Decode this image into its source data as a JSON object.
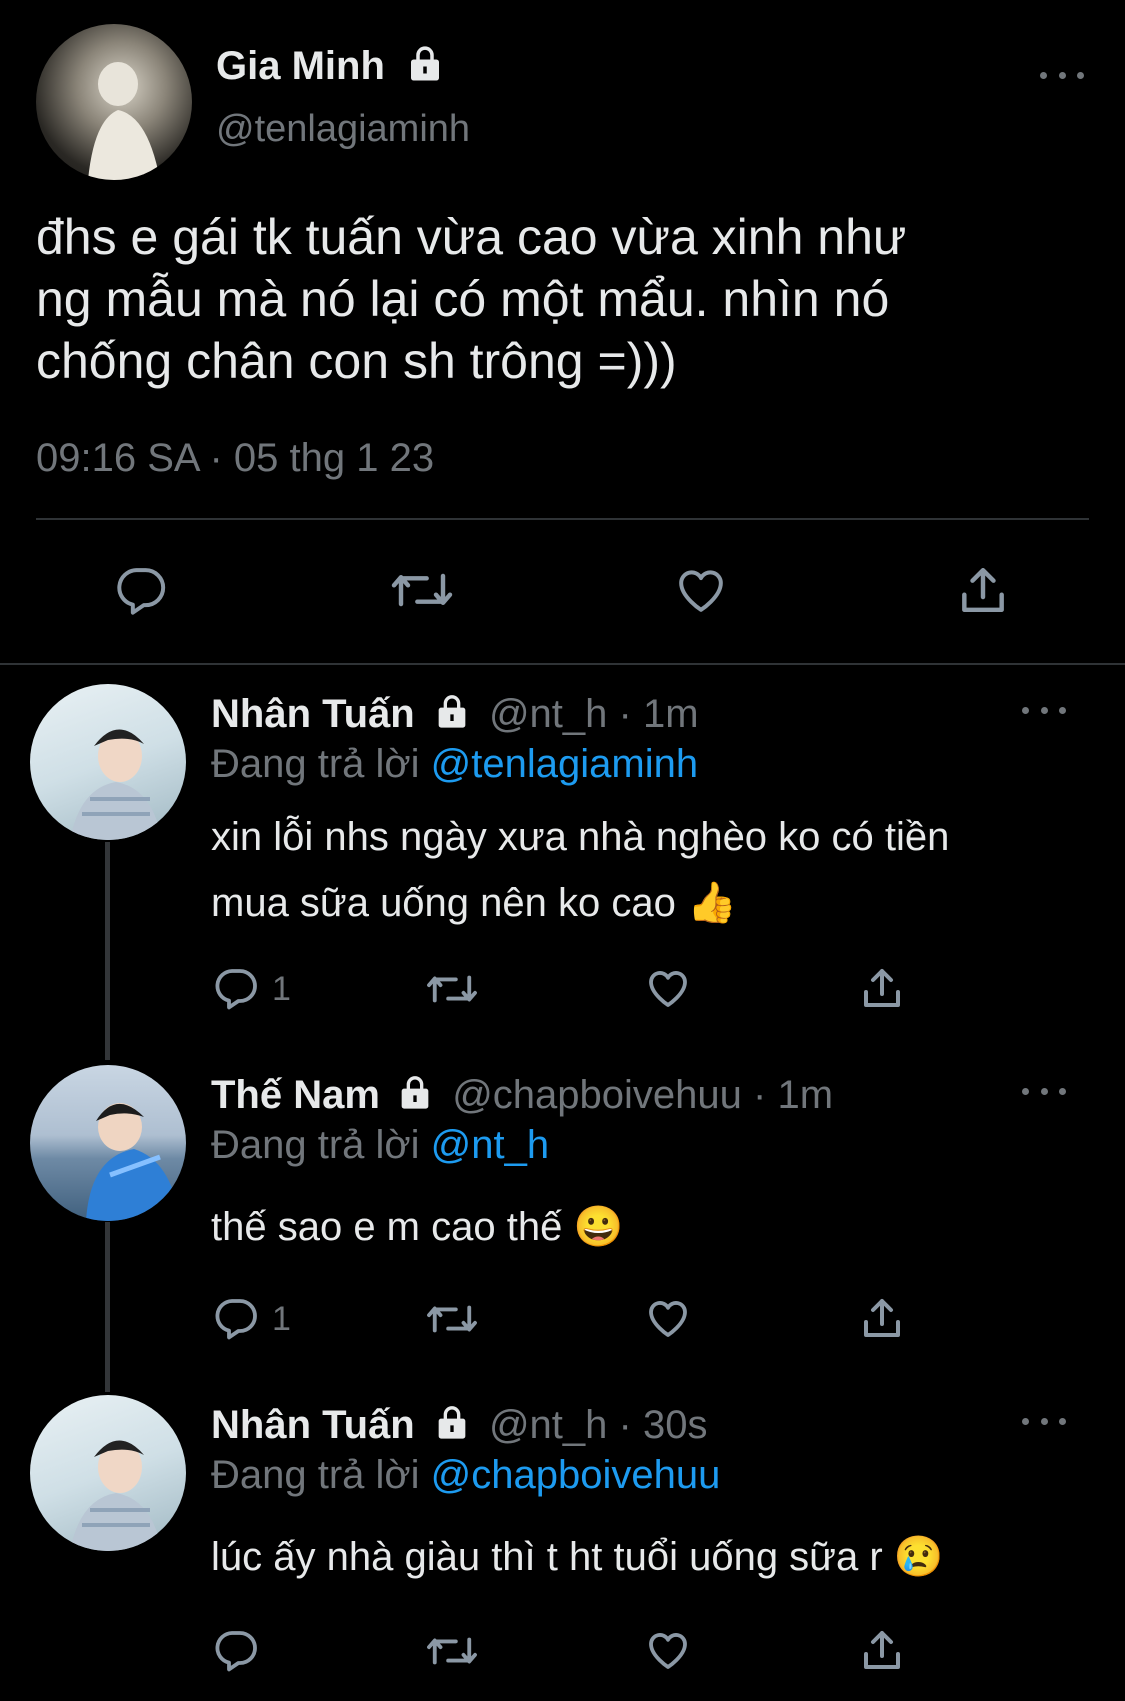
{
  "main_tweet": {
    "display_name": "Gia Minh",
    "handle": "@tenlagiaminh",
    "text_lines": [
      "đhs e gái tk tuấn vừa cao vừa xinh như",
      "ng mẫu mà nó lại có một mẩu. nhìn nó",
      "chống chân con sh trông =)))"
    ],
    "timestamp": "09:16 SA · 05 thg 1 23"
  },
  "replies": [
    {
      "display_name": "Nhân Tuấn",
      "handle": "@nt_h",
      "time": "· 1m",
      "replying_prefix": "Đang trả lời",
      "replying_to": "@tenlagiaminh",
      "text_lines": [
        "xin lỗi nhs ngày xưa nhà nghèo ko có tiền",
        "mua sữa uống nên ko cao 👍"
      ],
      "reply_count": "1"
    },
    {
      "display_name": "Thế Nam",
      "handle": "@chapboivehuu",
      "time": "· 1m",
      "replying_prefix": "Đang trả lời",
      "replying_to": "@nt_h",
      "text_lines": [
        "thế sao e m cao thế 😀"
      ],
      "reply_count": "1"
    },
    {
      "display_name": "Nhân Tuấn",
      "handle": "@nt_h",
      "time": "· 30s",
      "replying_prefix": "Đang trả lời",
      "replying_to": "@chapboivehuu",
      "text_lines": [
        "lúc ấy nhà giàu thì t ht tuổi uống sữa r 😢"
      ],
      "reply_count": ""
    }
  ],
  "colors": {
    "background": "#000000",
    "text": "#e7e9ea",
    "muted": "#71767b",
    "link": "#1d9bf0",
    "divider": "#2f3336"
  },
  "icons": [
    "lock-icon",
    "more-icon",
    "reply-icon",
    "retweet-icon",
    "like-icon",
    "share-icon"
  ]
}
